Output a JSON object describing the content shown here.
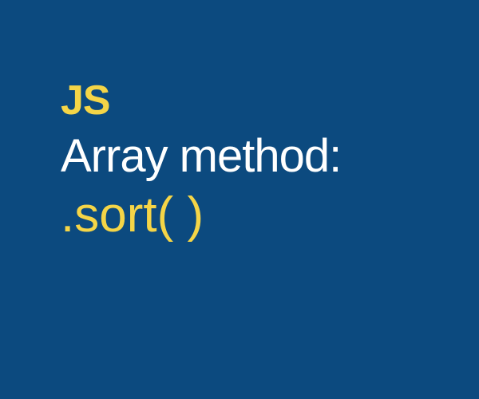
{
  "card": {
    "label": "JS",
    "title": "Array method:",
    "method": ".sort( )"
  }
}
